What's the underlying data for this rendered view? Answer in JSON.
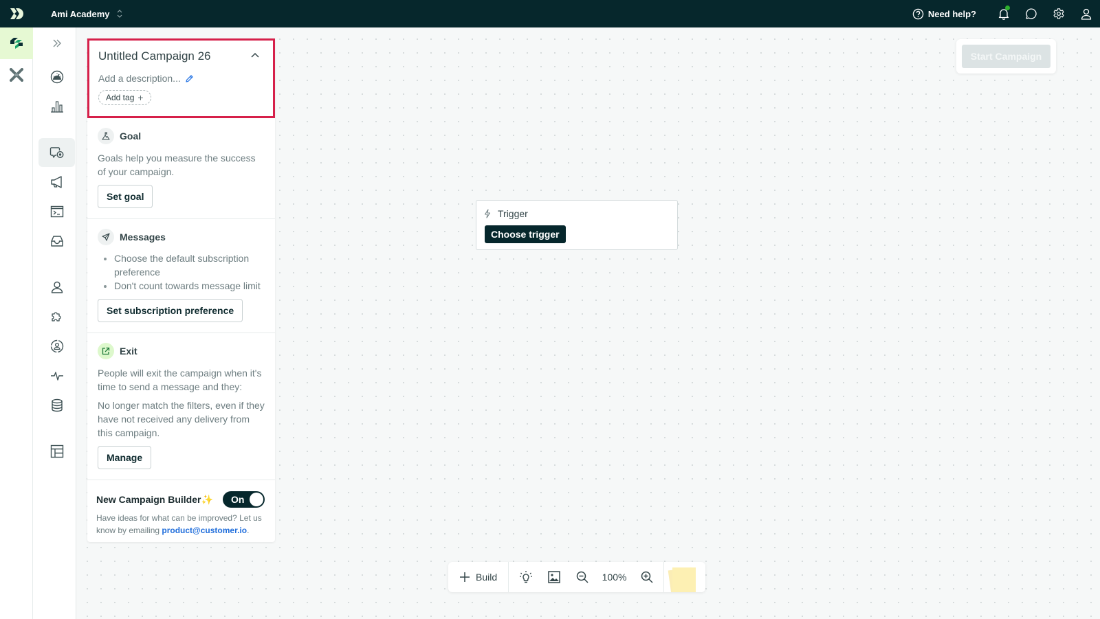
{
  "topbar": {
    "workspace": "Ami Academy",
    "help_label": "Need help?",
    "notification_dot_color": "#2db02d"
  },
  "rail1": {
    "items": [
      {
        "name": "journeys-app",
        "active": true
      },
      {
        "name": "pipelines-app",
        "active": false
      }
    ]
  },
  "rail2": {
    "items": [
      {
        "icon": "expand-icon"
      },
      {
        "icon": "dashboard-icon"
      },
      {
        "icon": "analytics-icon"
      },
      {
        "icon": "campaigns-icon",
        "active": true
      },
      {
        "icon": "broadcasts-icon"
      },
      {
        "icon": "transactional-icon"
      },
      {
        "icon": "inbox-icon"
      },
      {
        "icon": "people-icon"
      },
      {
        "icon": "integrations-icon"
      },
      {
        "icon": "segments-icon"
      },
      {
        "icon": "activity-icon"
      },
      {
        "icon": "data-icon"
      },
      {
        "icon": "content-icon"
      }
    ]
  },
  "panel": {
    "title": "Untitled Campaign 26",
    "description_placeholder": "Add a description...",
    "add_tag_label": "Add tag",
    "goal": {
      "title": "Goal",
      "text": "Goals help you measure the success of your campaign.",
      "button": "Set goal"
    },
    "messages": {
      "title": "Messages",
      "bullets": [
        "Choose the default subscription preference",
        "Don't count towards message limit"
      ],
      "button": "Set subscription preference"
    },
    "exit": {
      "title": "Exit",
      "text1": "People will exit the campaign when it's time to send a message and they:",
      "text2": "No longer match the filters, even if they have not received any delivery from this campaign.",
      "button": "Manage"
    },
    "builder": {
      "title": "New Campaign Builder",
      "sparkle": "✨",
      "toggle_label": "On",
      "toggle_on": true,
      "text_before": "Have ideas for what can be improved? Let us know by emailing ",
      "email": "product@customer.io",
      "text_after": "."
    }
  },
  "trigger": {
    "label": "Trigger",
    "button": "Choose trigger"
  },
  "start_campaign": {
    "label": "Start Campaign",
    "disabled": true
  },
  "toolbar": {
    "build_label": "Build",
    "zoom_level": "100%"
  },
  "colors": {
    "topbar_bg": "#06272c",
    "highlight_border": "#d6204a",
    "active_app_bg": "#e6f9d3",
    "link": "#1f6ddb"
  }
}
